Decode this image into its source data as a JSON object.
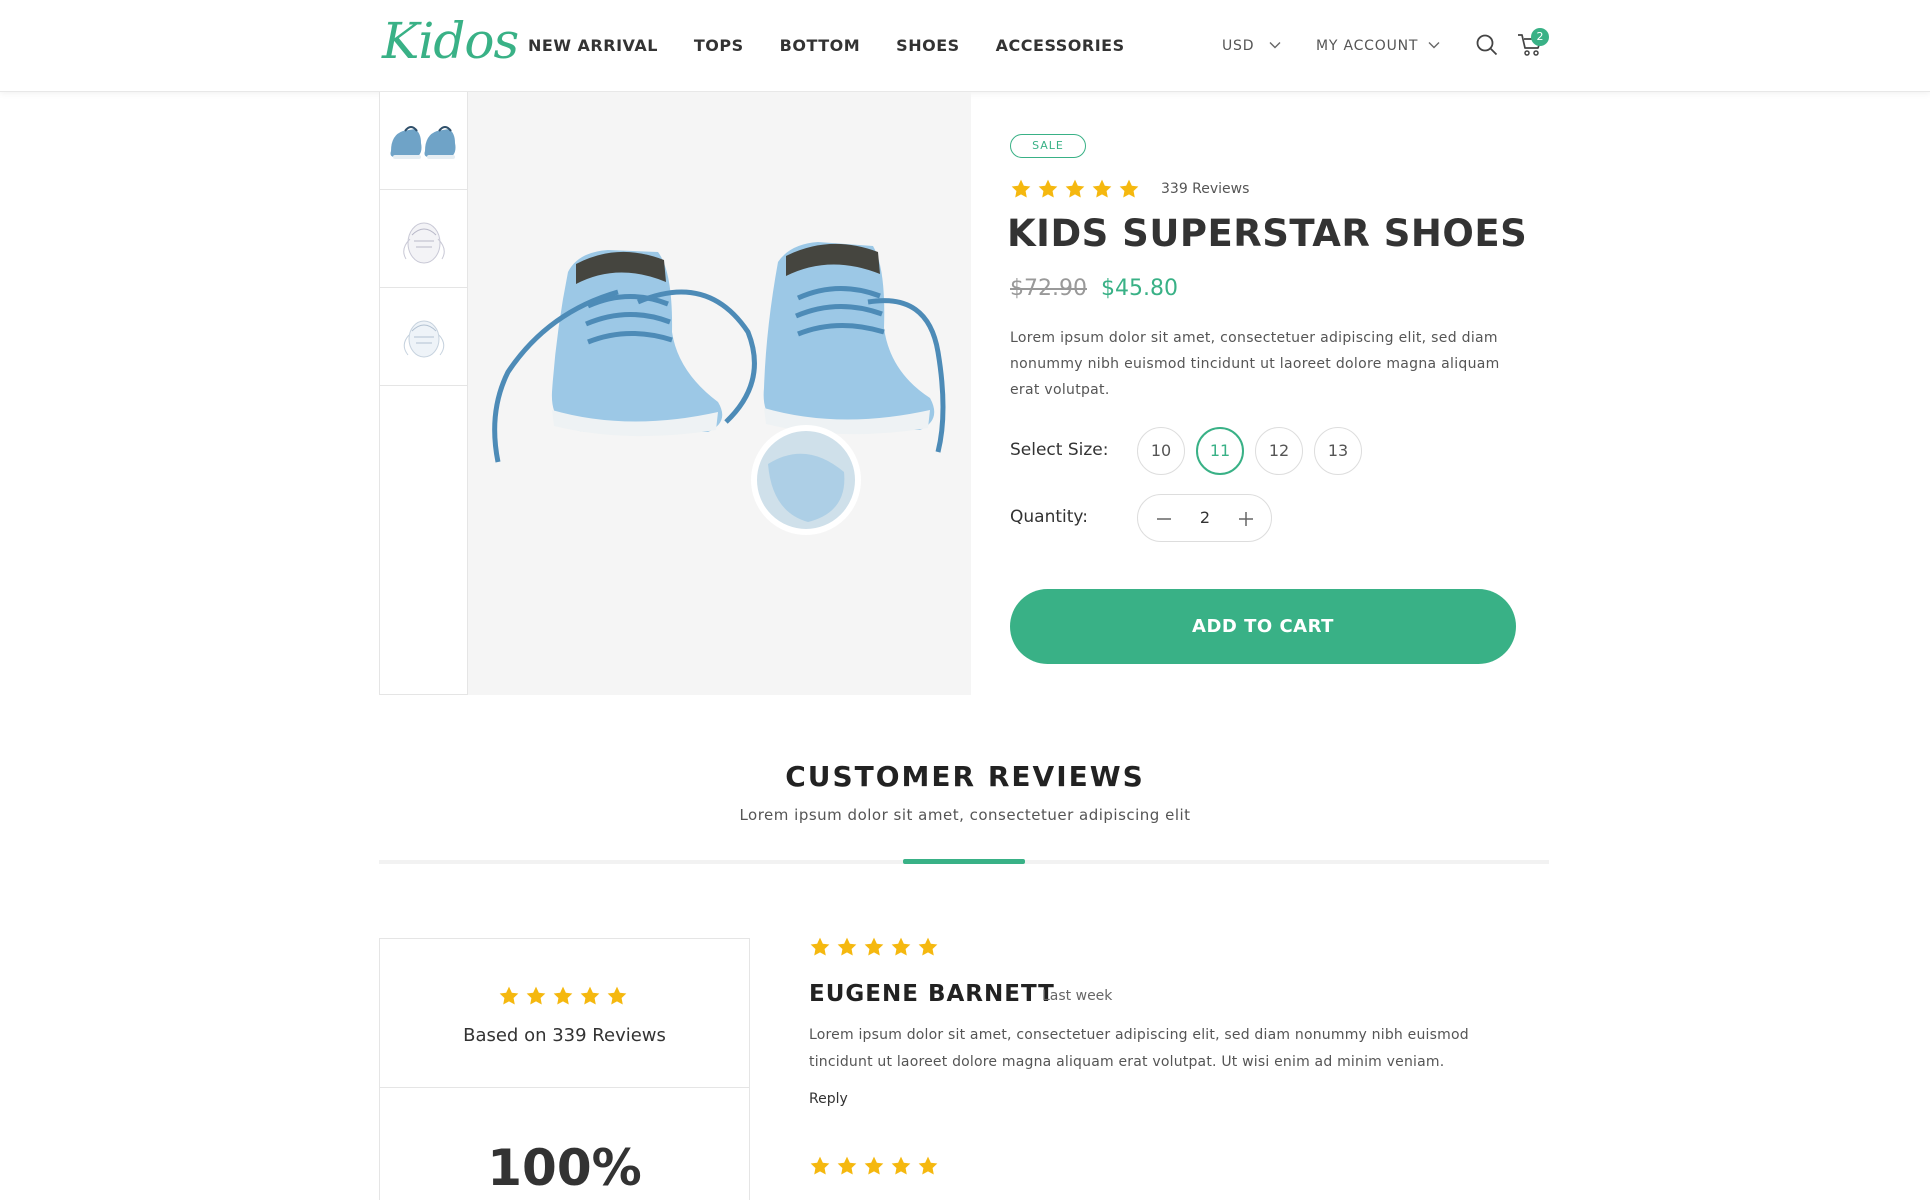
{
  "header": {
    "logo": "Kidos",
    "nav": [
      "NEW ARRIVAL",
      "TOPS",
      "BOTTOM",
      "SHOES",
      "ACCESSORIES"
    ],
    "currency": "USD",
    "account": "MY ACCOUNT",
    "cart_count": "2",
    "accent_color": "#39b186"
  },
  "product": {
    "badge": "SALE",
    "rating": 5,
    "reviews_label": "339 Reviews",
    "title": "KIDS SUPERSTAR SHOES",
    "old_price": "$72.90",
    "new_price": "$45.80",
    "description": "Lorem ipsum dolor sit amet, consectetuer adipiscing elit, sed diam nonummy nibh euismod tincidunt ut laoreet dolore magna aliquam erat volutpat.",
    "size_label": "Select Size:",
    "sizes": [
      "10",
      "11",
      "12",
      "13"
    ],
    "selected_size": "11",
    "quantity_label": "Quantity:",
    "quantity": "2",
    "add_to_cart": "ADD TO CART"
  },
  "reviews_section": {
    "title": "CUSTOMER REVIEWS",
    "subtitle": "Lorem ipsum dolor sit amet, consectetuer adipiscing elit",
    "summary": {
      "rating": 5,
      "based_on": "Based on 339 Reviews",
      "percent": "100%"
    },
    "reviews": [
      {
        "rating": 5,
        "name": "EUGENE BARNETT",
        "time": "Last week",
        "text": "Lorem ipsum dolor sit amet, consectetuer adipiscing elit, sed diam nonummy nibh euismod tincidunt ut laoreet dolore magna aliquam erat volutpat. Ut wisi enim ad minim veniam.",
        "reply": "Reply"
      },
      {
        "rating": 5
      }
    ]
  }
}
